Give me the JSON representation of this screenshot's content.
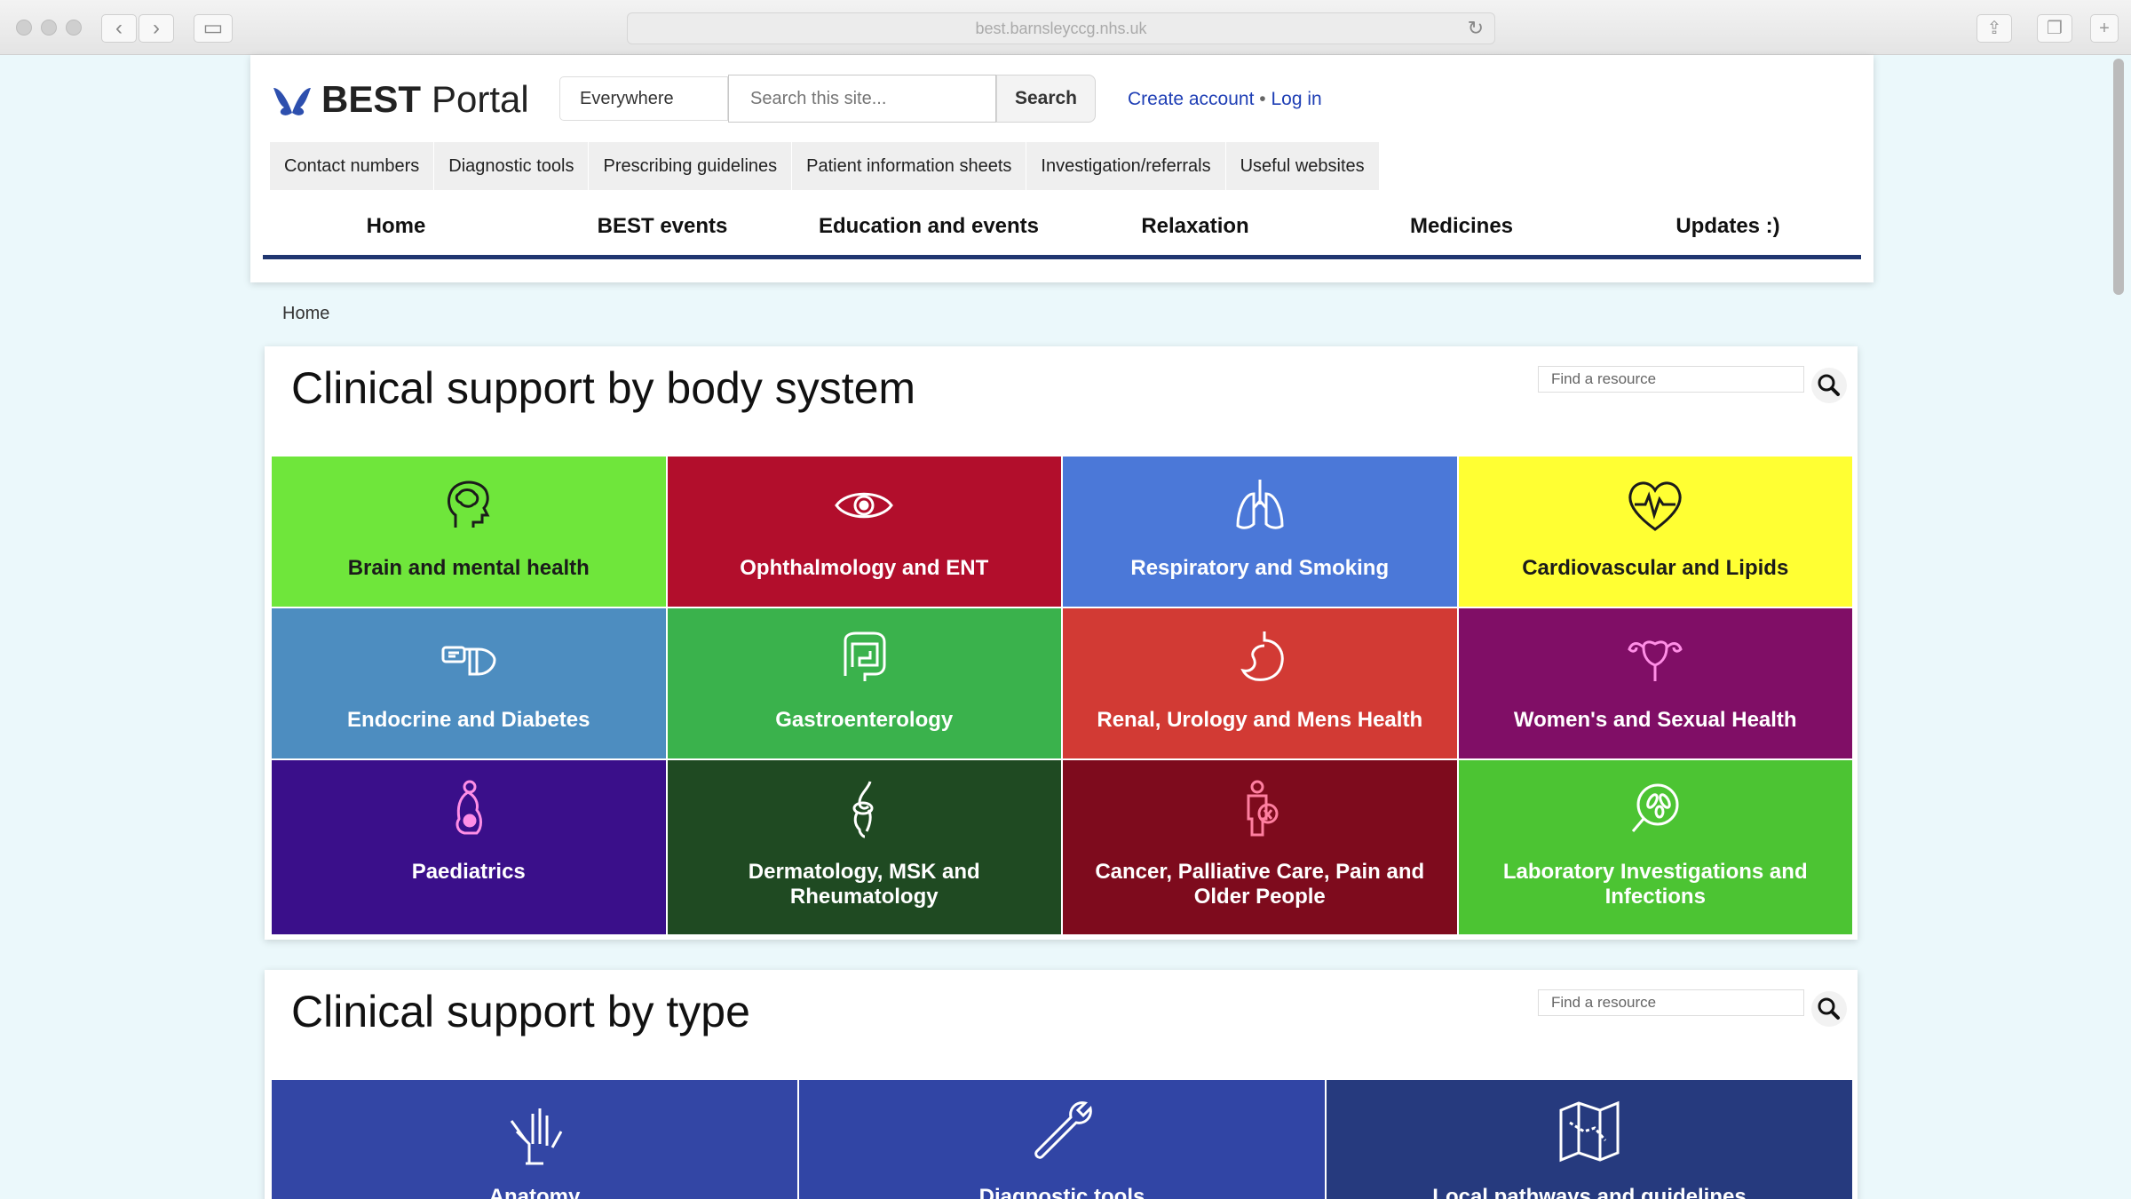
{
  "browser": {
    "url": "best.barnsleyccg.nhs.uk"
  },
  "header": {
    "logo_bold": "BEST",
    "logo_light": "Portal",
    "scope_value": "Everywhere",
    "search_placeholder": "Search this site...",
    "search_button": "Search",
    "create_account": "Create account",
    "separator": "•",
    "log_in": "Log in",
    "quick_links": [
      "Contact numbers",
      "Diagnostic tools",
      "Prescribing guidelines",
      "Patient information sheets",
      "Investigation/referrals",
      "Useful websites"
    ],
    "main_nav": [
      "Home",
      "BEST events",
      "Education and events",
      "Relaxation",
      "Medicines",
      "Updates :)"
    ]
  },
  "breadcrumb": "Home",
  "body_system": {
    "title": "Clinical support by body system",
    "find_placeholder": "Find a resource",
    "tiles": [
      {
        "label": "Brain and mental health",
        "icon": "brain-head-icon",
        "bg": "#6fe63b",
        "fg": "#1b1b1b"
      },
      {
        "label": "Ophthalmology and ENT",
        "icon": "eye-icon",
        "bg": "#b20e2c",
        "fg": "#ffffff"
      },
      {
        "label": "Respiratory and Smoking",
        "icon": "lungs-icon",
        "bg": "#4b78d8",
        "fg": "#ffffff"
      },
      {
        "label": "Cardiovascular and Lipids",
        "icon": "heart-pulse-icon",
        "bg": "#ffff33",
        "fg": "#1b1b1b"
      },
      {
        "label": "Endocrine and Diabetes",
        "icon": "glucose-meter-icon",
        "bg": "#4d8dc0",
        "fg": "#ffffff"
      },
      {
        "label": "Gastroenterology",
        "icon": "intestine-icon",
        "bg": "#3ab24c",
        "fg": "#ffffff"
      },
      {
        "label": "Renal, Urology and Mens Health",
        "icon": "kidney-icon",
        "bg": "#d23a34",
        "fg": "#ffffff"
      },
      {
        "label": "Women's and Sexual Health",
        "icon": "uterus-icon",
        "bg": "#800e66",
        "fg": "#ffffff"
      },
      {
        "label": "Paediatrics",
        "icon": "pregnancy-icon",
        "bg": "#3a0f8a",
        "fg": "#ffffff"
      },
      {
        "label": "Dermatology, MSK and Rheumatology",
        "icon": "knee-joint-icon",
        "bg": "#1f4a22",
        "fg": "#ffffff"
      },
      {
        "label": "Cancer, Palliative Care, Pain and Older People",
        "icon": "person-ribbon-icon",
        "bg": "#7e0b1d",
        "fg": "#ffffff"
      },
      {
        "label": "Laboratory Investigations and Infections",
        "icon": "bacteria-magnifier-icon",
        "bg": "#4cc433",
        "fg": "#ffffff"
      }
    ]
  },
  "by_type": {
    "title": "Clinical support by type",
    "find_placeholder": "Find a resource",
    "tiles": [
      {
        "label": "Anatomy",
        "icon": "hand-bones-icon",
        "bg": "#3346a5"
      },
      {
        "label": "Diagnostic tools",
        "icon": "wrench-icon",
        "bg": "#3145a5"
      },
      {
        "label": "Local pathways and guidelines",
        "icon": "map-icon",
        "bg": "#263a7e"
      }
    ]
  }
}
